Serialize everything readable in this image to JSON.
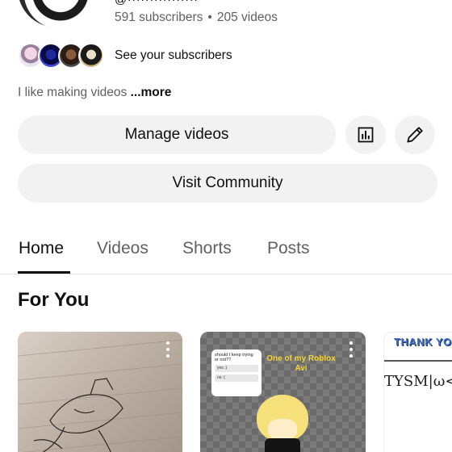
{
  "channel": {
    "handle_partial": "@················",
    "subscribers": "591 subscribers",
    "separator": "•",
    "videos": "205 videos",
    "see_subscribers_label": "See your subscribers",
    "description": "I like making videos",
    "more_label": "...more"
  },
  "actions": {
    "manage_videos_label": "Manage videos",
    "visit_community_label": "Visit Community",
    "analytics_icon": "analytics-icon",
    "edit_icon": "pencil-icon"
  },
  "tabs": [
    {
      "label": "Home",
      "active": true
    },
    {
      "label": "Videos",
      "active": false
    },
    {
      "label": "Shorts",
      "active": false
    },
    {
      "label": "Posts",
      "active": false
    }
  ],
  "section": {
    "title": "For You"
  },
  "thumbnails": [
    {
      "kind": "sketch"
    },
    {
      "kind": "poll",
      "poll_question": "should I keep trying or not??",
      "poll_option_1": "yes :)",
      "poll_option_2": "no :(",
      "caption": "One of my Roblox Avi"
    },
    {
      "kind": "thanks",
      "title": "THANK YO",
      "handwriting": "TYSM|ω<"
    }
  ],
  "colors": {
    "text_primary": "#0f0f0f",
    "text_secondary": "#606060",
    "pill_bg": "#f2f2f2",
    "divider": "#e5e5e5"
  }
}
